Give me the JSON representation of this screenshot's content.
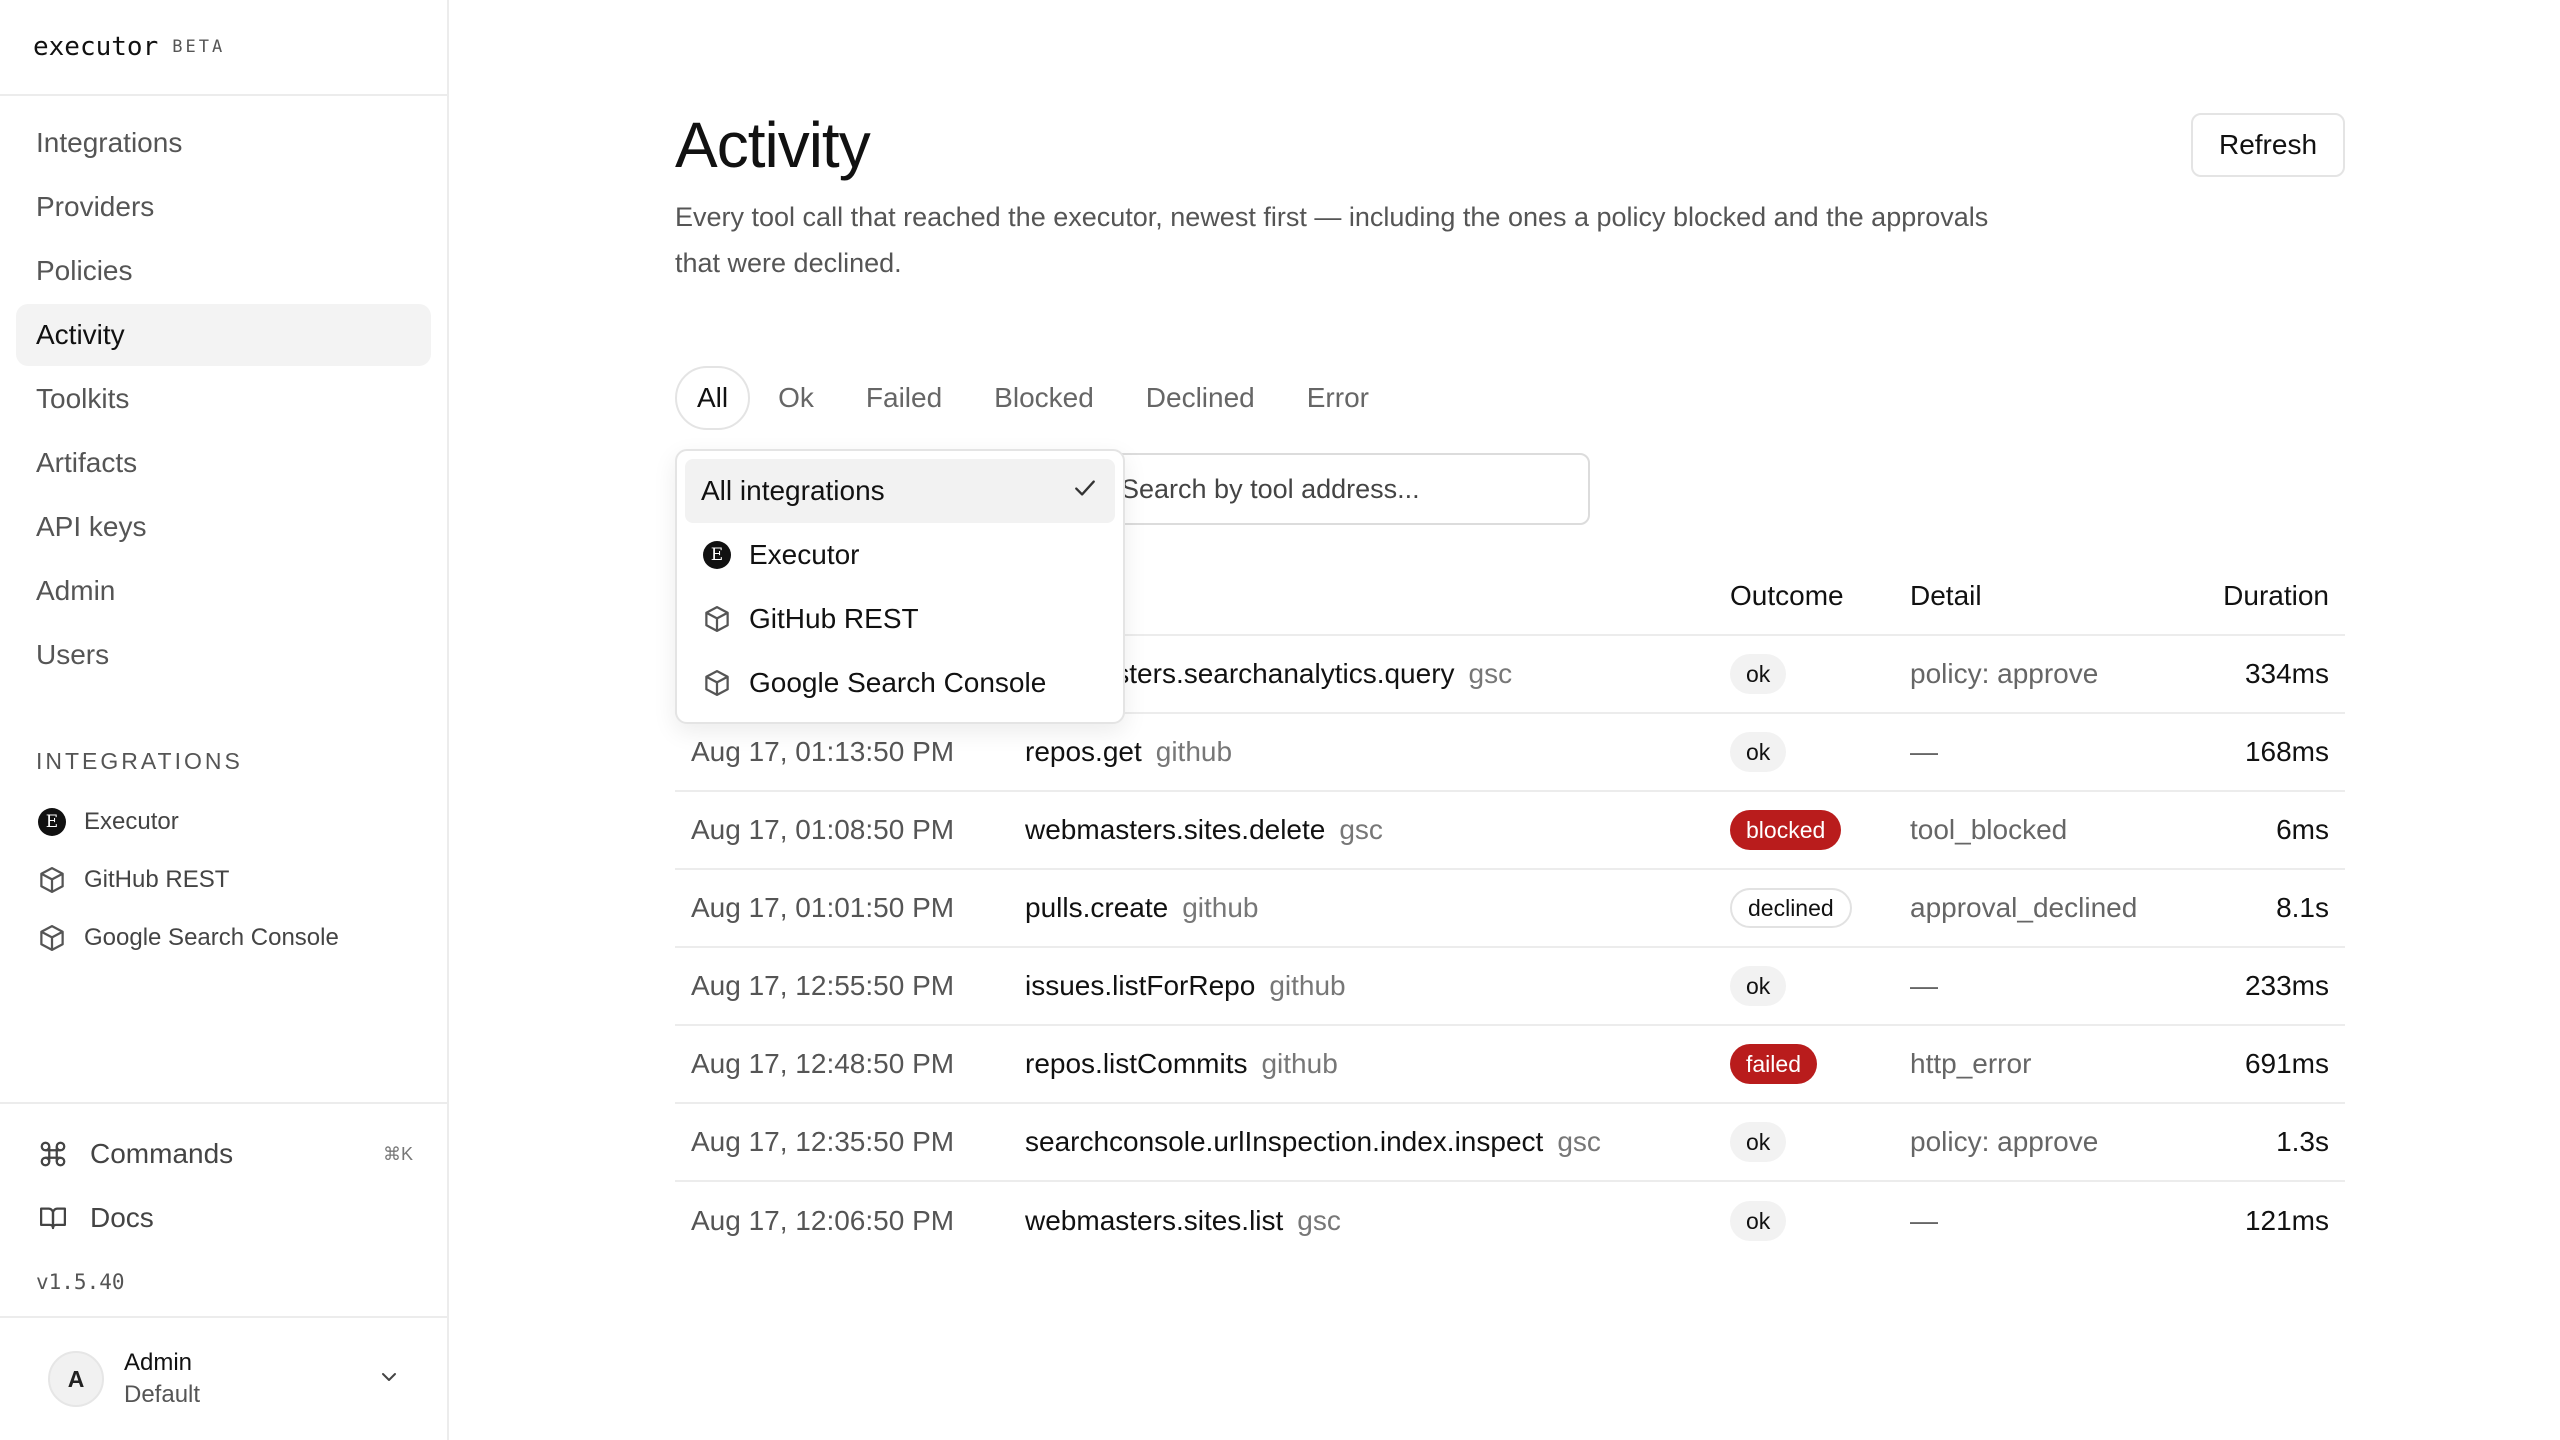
{
  "brand": {
    "name": "executor",
    "badge": "BETA"
  },
  "nav": [
    {
      "label": "Integrations"
    },
    {
      "label": "Providers"
    },
    {
      "label": "Policies"
    },
    {
      "label": "Activity"
    },
    {
      "label": "Toolkits"
    },
    {
      "label": "Artifacts"
    },
    {
      "label": "API keys"
    },
    {
      "label": "Admin"
    },
    {
      "label": "Users"
    }
  ],
  "integrations_section": {
    "title": "INTEGRATIONS",
    "items": [
      {
        "label": "Executor",
        "icon": "executor-logo-icon"
      },
      {
        "label": "GitHub REST",
        "icon": "cube-icon"
      },
      {
        "label": "Google Search Console",
        "icon": "cube-icon"
      }
    ]
  },
  "bottom": {
    "commands_label": "Commands",
    "commands_shortcut": "⌘K",
    "docs_label": "Docs",
    "version": "v1.5.40",
    "user": {
      "initial": "A",
      "name": "Admin",
      "workspace": "Default"
    }
  },
  "page": {
    "title": "Activity",
    "description": "Every tool call that reached the executor, newest first — including the ones a policy blocked and the approvals that were declined.",
    "refresh_label": "Refresh"
  },
  "tabs": [
    {
      "label": "All"
    },
    {
      "label": "Ok"
    },
    {
      "label": "Failed"
    },
    {
      "label": "Blocked"
    },
    {
      "label": "Declined"
    },
    {
      "label": "Error"
    }
  ],
  "search": {
    "placeholder": "Search by tool address..."
  },
  "dropdown": {
    "options": [
      {
        "label": "All integrations",
        "selected": true
      },
      {
        "label": "Executor",
        "icon": "executor-logo-icon"
      },
      {
        "label": "GitHub REST",
        "icon": "cube-icon"
      },
      {
        "label": "Google Search Console",
        "icon": "cube-icon"
      }
    ]
  },
  "table": {
    "columns": {
      "outcome": "Outcome",
      "detail": "Detail",
      "duration": "Duration"
    },
    "rows": [
      {
        "time": "",
        "tool": "webmasters.searchanalytics.query",
        "integration": "gsc",
        "outcome": "ok",
        "detail": "policy: approve",
        "duration": "334ms"
      },
      {
        "time": "Aug 17, 01:13:50 PM",
        "tool": "repos.get",
        "integration": "github",
        "outcome": "ok",
        "detail": "—",
        "duration": "168ms"
      },
      {
        "time": "Aug 17, 01:08:50 PM",
        "tool": "webmasters.sites.delete",
        "integration": "gsc",
        "outcome": "blocked",
        "detail": "tool_blocked",
        "duration": "6ms"
      },
      {
        "time": "Aug 17, 01:01:50 PM",
        "tool": "pulls.create",
        "integration": "github",
        "outcome": "declined",
        "detail": "approval_declined",
        "duration": "8.1s"
      },
      {
        "time": "Aug 17, 12:55:50 PM",
        "tool": "issues.listForRepo",
        "integration": "github",
        "outcome": "ok",
        "detail": "—",
        "duration": "233ms"
      },
      {
        "time": "Aug 17, 12:48:50 PM",
        "tool": "repos.listCommits",
        "integration": "github",
        "outcome": "failed",
        "detail": "http_error",
        "duration": "691ms"
      },
      {
        "time": "Aug 17, 12:35:50 PM",
        "tool": "searchconsole.urlInspection.index.inspect",
        "integration": "gsc",
        "outcome": "ok",
        "detail": "policy: approve",
        "duration": "1.3s"
      },
      {
        "time": "Aug 17, 12:06:50 PM",
        "tool": "webmasters.sites.list",
        "integration": "gsc",
        "outcome": "ok",
        "detail": "—",
        "duration": "121ms"
      }
    ]
  },
  "colors": {
    "danger": "#b91c1c",
    "active_bg": "#f3f3f3",
    "border": "#ececec"
  }
}
